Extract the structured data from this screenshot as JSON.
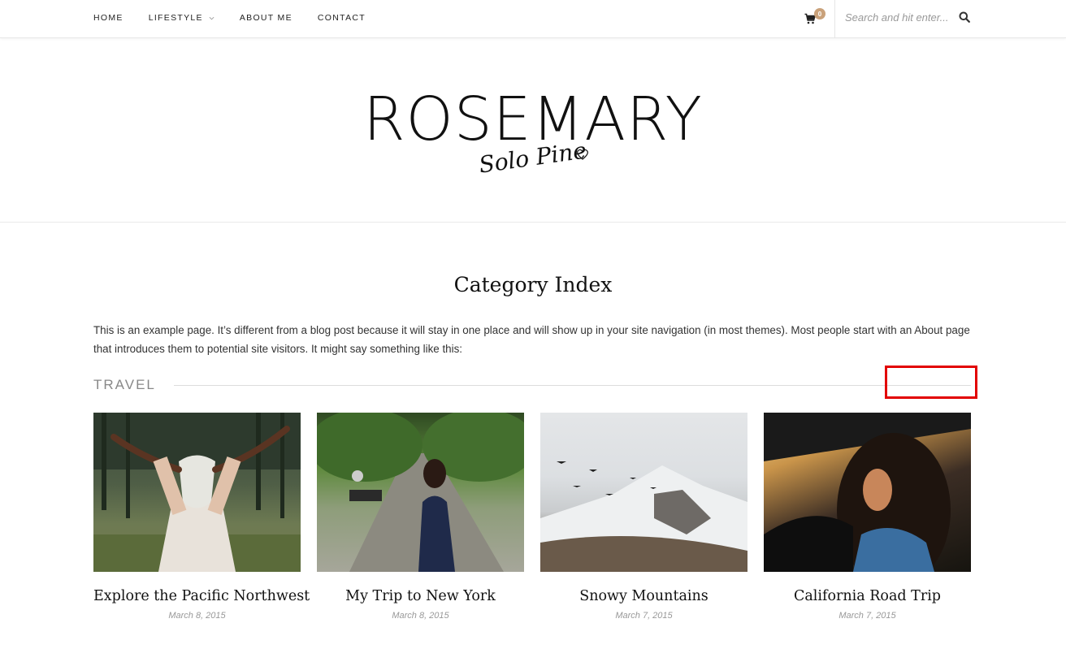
{
  "nav": {
    "items": [
      {
        "label": "HOME"
      },
      {
        "label": "LIFESTYLE",
        "has_dropdown": true
      },
      {
        "label": "ABOUT ME"
      },
      {
        "label": "CONTACT"
      }
    ],
    "cart_count": "0",
    "search_placeholder": "Search and hit enter..."
  },
  "header": {
    "logo": "ROSEMARY",
    "tagline": "Solo Pine"
  },
  "page": {
    "title": "Category Index",
    "intro": "This is an example page. It’s different from a blog post because it will stay in one place and will show up in your site navigation (in most themes). Most people start with an About page that introduces them to potential site visitors. It might say something like this:"
  },
  "section": {
    "title": "TRAVEL"
  },
  "posts": [
    {
      "title": "Explore the Pacific Northwest",
      "date": "March 8, 2015"
    },
    {
      "title": "My Trip to New York",
      "date": "March 8, 2015"
    },
    {
      "title": "Snowy Mountains",
      "date": "March 7, 2015"
    },
    {
      "title": "California Road Trip",
      "date": "March 7, 2015"
    }
  ],
  "colors": {
    "accent": "#c9a17a",
    "highlight": "#e20000"
  }
}
